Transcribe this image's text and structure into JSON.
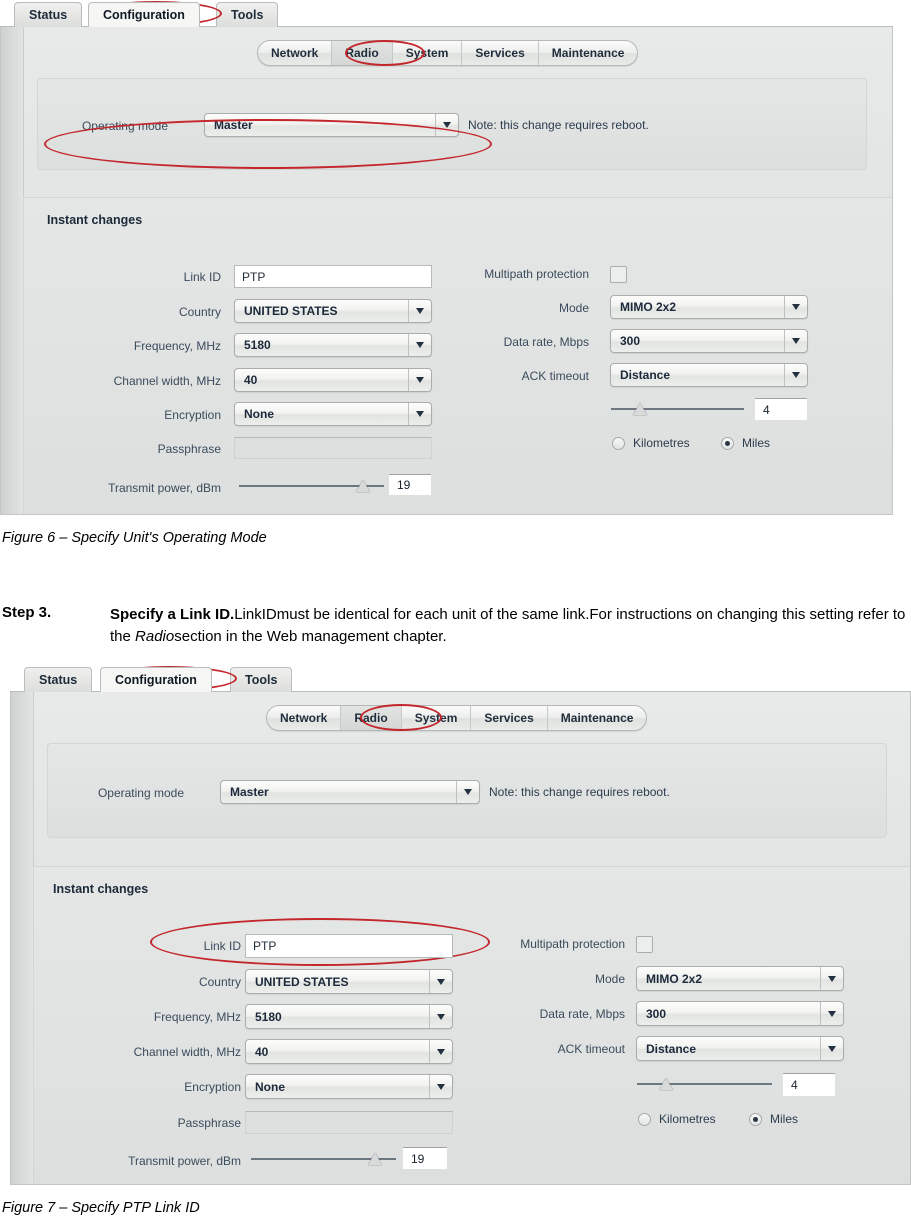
{
  "document": {
    "figure6_caption": "Figure 6 – Specify Unit's Operating Mode",
    "figure7_caption": "Figure 7 – Specify PTP Link ID",
    "step": {
      "number": "Step 3.",
      "lead": "Specify a Link ID.",
      "text_part1": "LinkIDmust be identical for each unit of the same link.For instructions on changing this setting refer to the ",
      "emphasis": "Radio",
      "text_part2": "section in the Web management chapter."
    }
  },
  "colors": {
    "annotation_red": "#c3262b",
    "panel_bg": "#e0e3e2",
    "card_bg": "#e3e6e5",
    "label_text": "#3b4b5c",
    "value_text": "#1b293a"
  },
  "figure6": {
    "main_tabs": [
      {
        "label": "Status",
        "selected": false
      },
      {
        "label": "Configuration",
        "selected": true
      },
      {
        "label": "Tools",
        "selected": false
      }
    ],
    "sub_tabs": [
      {
        "label": "Network",
        "selected": false
      },
      {
        "label": "Radio",
        "selected": true
      },
      {
        "label": "System",
        "selected": false
      },
      {
        "label": "Services",
        "selected": false
      },
      {
        "label": "Maintenance",
        "selected": false
      }
    ],
    "operating_mode": {
      "label": "Operating mode",
      "value": "Master",
      "note": "Note: this change requires reboot."
    },
    "instant_changes": {
      "title": "Instant changes",
      "link_id": {
        "label": "Link ID",
        "value": "PTP"
      },
      "country": {
        "label": "Country",
        "value": "UNITED STATES"
      },
      "frequency": {
        "label": "Frequency, MHz",
        "value": "5180"
      },
      "channel_width": {
        "label": "Channel width, MHz",
        "value": "40"
      },
      "encryption": {
        "label": "Encryption",
        "value": "None"
      },
      "passphrase": {
        "label": "Passphrase",
        "value": ""
      },
      "transmit_power": {
        "label": "Transmit power, dBm",
        "value": "19",
        "slider_percent": 92
      },
      "multipath": {
        "label": "Multipath protection",
        "checked": false
      },
      "mode": {
        "label": "Mode",
        "value": "MIMO 2x2"
      },
      "data_rate": {
        "label": "Data rate, Mbps",
        "value": "300"
      },
      "ack_timeout": {
        "label": "ACK timeout",
        "value": "Distance"
      },
      "distance": {
        "value": "4",
        "slider_percent": 22
      },
      "units": {
        "kilometres_label": "Kilometres",
        "miles_label": "Miles",
        "selected": "Miles"
      }
    },
    "annotations": [
      "configuration-tab-highlight",
      "radio-subtab-highlight",
      "operating-mode-row-highlight"
    ]
  },
  "figure7": {
    "main_tabs": [
      {
        "label": "Status",
        "selected": false
      },
      {
        "label": "Configuration",
        "selected": true
      },
      {
        "label": "Tools",
        "selected": false
      }
    ],
    "sub_tabs": [
      {
        "label": "Network",
        "selected": false
      },
      {
        "label": "Radio",
        "selected": true
      },
      {
        "label": "System",
        "selected": false
      },
      {
        "label": "Services",
        "selected": false
      },
      {
        "label": "Maintenance",
        "selected": false
      }
    ],
    "operating_mode": {
      "label": "Operating mode",
      "value": "Master",
      "note": "Note: this change requires reboot."
    },
    "instant_changes": {
      "title": "Instant changes",
      "link_id": {
        "label": "Link ID",
        "value": "PTP"
      },
      "country": {
        "label": "Country",
        "value": "UNITED STATES"
      },
      "frequency": {
        "label": "Frequency, MHz",
        "value": "5180"
      },
      "channel_width": {
        "label": "Channel width, MHz",
        "value": "40"
      },
      "encryption": {
        "label": "Encryption",
        "value": "None"
      },
      "passphrase": {
        "label": "Passphrase",
        "value": ""
      },
      "transmit_power": {
        "label": "Transmit power, dBm",
        "value": "19",
        "slider_percent": 92
      },
      "multipath": {
        "label": "Multipath protection",
        "checked": false
      },
      "mode": {
        "label": "Mode",
        "value": "MIMO 2x2"
      },
      "data_rate": {
        "label": "Data rate, Mbps",
        "value": "300"
      },
      "ack_timeout": {
        "label": "ACK timeout",
        "value": "Distance"
      },
      "distance": {
        "value": "4",
        "slider_percent": 22
      },
      "units": {
        "kilometres_label": "Kilometres",
        "miles_label": "Miles",
        "selected": "Miles"
      }
    },
    "annotations": [
      "configuration-tab-highlight",
      "radio-subtab-highlight",
      "link-id-row-highlight"
    ]
  }
}
